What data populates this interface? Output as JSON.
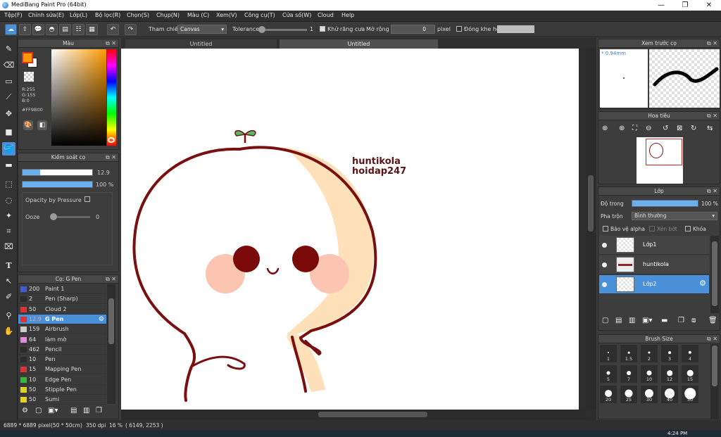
{
  "window": {
    "title": "MediBang Paint Pro (64bit)",
    "minimize": "—",
    "maximize": "❐",
    "close": "✕"
  },
  "menu": [
    "Tệp(F)",
    "Chỉnh sửa(E)",
    "Lớp(L)",
    "Bộ lọc(R)",
    "Chọn(S)",
    "Chụp(N)",
    "Màu (C)",
    "Xem(V)",
    "Công cụ(T)",
    "Cửa số(W)",
    "Cloud",
    "Help"
  ],
  "toolbar": {
    "tham_chieu": "Tham chiếu",
    "canvas_value": "Canvas",
    "tolerance_label": "Tolerance",
    "tolerance_value": "1",
    "antialias_label": "Khử răng cưa",
    "expand_label": "Mở rộng",
    "expand_value": "0",
    "pixel_label": "pixel",
    "close_gap_label": "Đóng khe hở"
  },
  "color_panel": {
    "title": "Màu",
    "r": "R:255",
    "g": "G:155",
    "b": "B:0",
    "hex": "#FF9B00",
    "fg_color": "#FF9B00"
  },
  "brush_control": {
    "title": "Kiểm soát cọ",
    "size_value": "12.9",
    "opacity_value": "100 %",
    "opacity_by_pressure": "Opacity by Pressure",
    "ooze_label": "Ooze",
    "ooze_value": "0"
  },
  "brush_list": {
    "title": "Cọ: G Pen",
    "items": [
      {
        "size": "200",
        "name": "Paint 1",
        "color": "#3c5bd8"
      },
      {
        "size": "2",
        "name": "Pen (Sharp)",
        "color": "#2b2b2b"
      },
      {
        "size": "50",
        "name": "Cloud 2",
        "color": "#e03030"
      },
      {
        "size": "12.9",
        "name": "G Pen",
        "color": "#e03030",
        "selected": true
      },
      {
        "size": "159",
        "name": "Airbrush",
        "color": "#cccccc"
      },
      {
        "size": "64",
        "name": "làm mờ",
        "color": "#e888e0"
      },
      {
        "size": "462",
        "name": "Pencil",
        "color": "#2b2b2b"
      },
      {
        "size": "10",
        "name": "Pen",
        "color": "#2b2b2b"
      },
      {
        "size": "15",
        "name": "Mapping Pen",
        "color": "#e03030"
      },
      {
        "size": "10",
        "name": "Edge Pen",
        "color": "#38b838"
      },
      {
        "size": "50",
        "name": "Stipple Pen",
        "color": "#e8d020"
      },
      {
        "size": "50",
        "name": "Sumi",
        "color": "#e8d020"
      }
    ]
  },
  "tabs": [
    "Untitled",
    "Untitled"
  ],
  "artwork": {
    "line1": "huntikola",
    "line2": "hoidap247"
  },
  "preview_panel": {
    "title": "Xem trước cọ",
    "size": "* 0.94mm"
  },
  "navigator_panel": {
    "title": "Hoa tiêu"
  },
  "layer_panel": {
    "title": "Lớp",
    "opacity_label": "Độ trong",
    "opacity_value": "100 %",
    "blend_label": "Pha trộn",
    "blend_value": "Bình thường",
    "protect_alpha": "Bảo vệ alpha",
    "clipping": "Xén bớt",
    "lock": "Khóa",
    "layers": [
      {
        "name": "Lớp1",
        "selected": false
      },
      {
        "name": "huntikola",
        "selected": false
      },
      {
        "name": "Lớp2",
        "selected": true
      }
    ]
  },
  "brush_size_panel": {
    "title": "Brush Size",
    "sizes": [
      "1",
      "1.5",
      "2",
      "3",
      "4",
      "5",
      "7",
      "10",
      "12",
      "15",
      "20",
      "25",
      "30",
      "40",
      "50"
    ]
  },
  "status": {
    "dimensions": "6889 * 6889 pixel",
    "physical": "(50 * 50cm)",
    "dpi": "350 dpi",
    "zoom": "16 %",
    "coords": "( 6149, 2253 )"
  },
  "taskbar": {
    "time": "4:24 PM"
  }
}
